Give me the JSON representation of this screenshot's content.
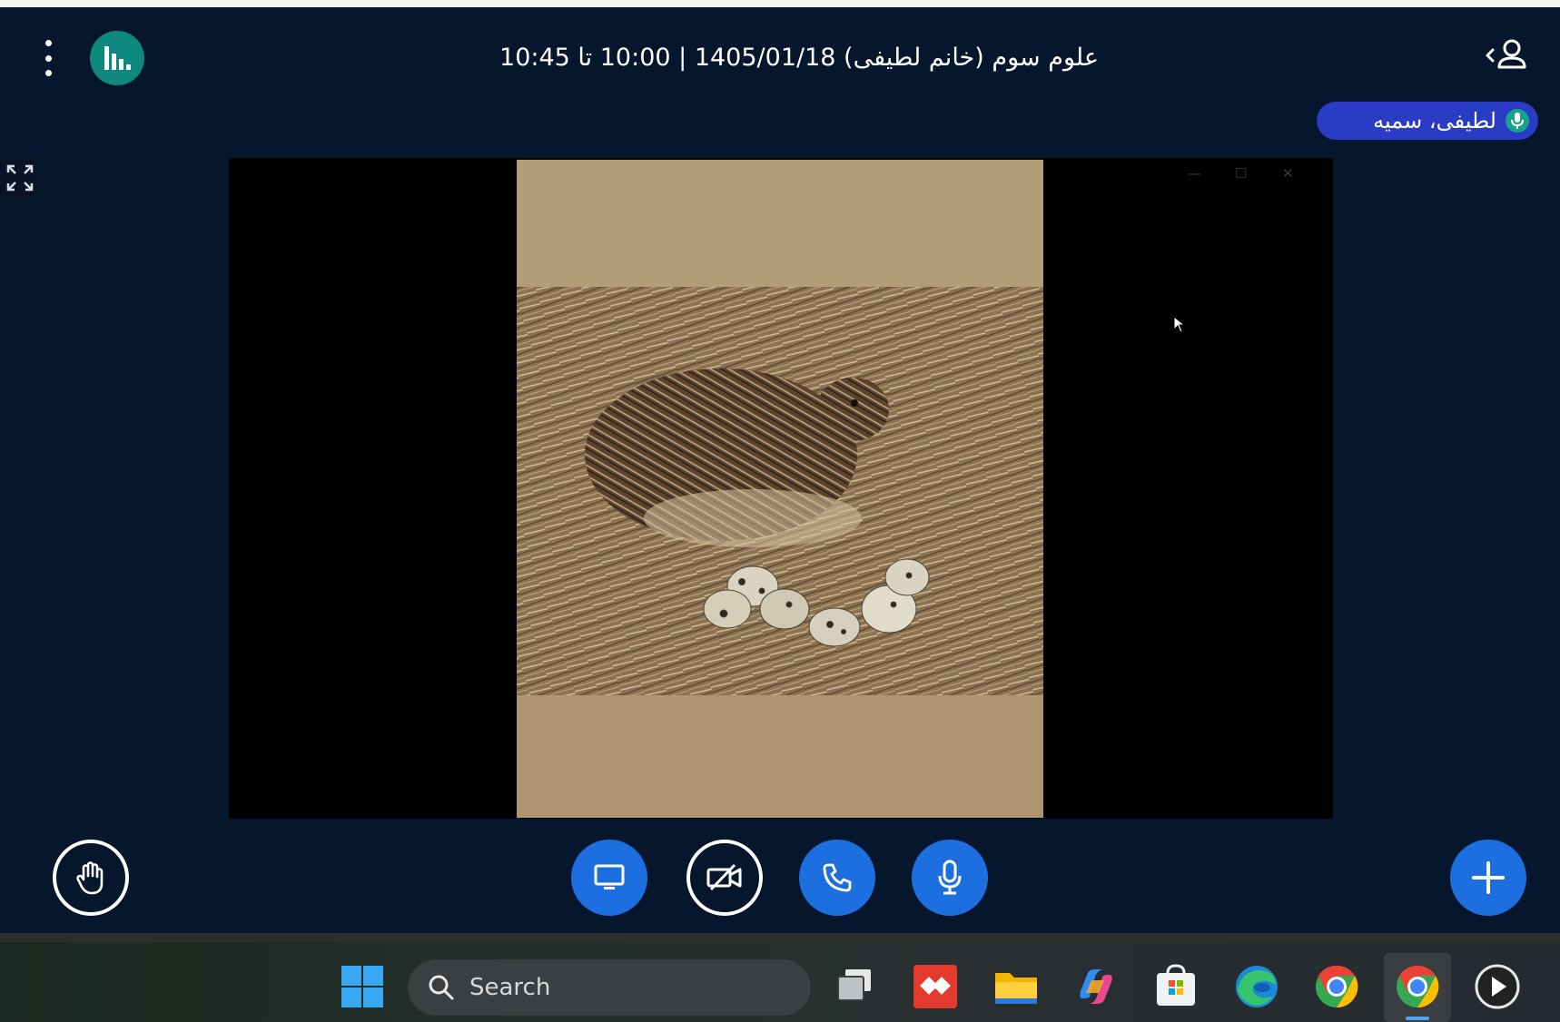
{
  "session": {
    "title": "علوم سوم (خانم لطیفی) 1405/01/18 | 10:00 تا 10:45"
  },
  "talker": {
    "name": "لطیفی، سمیه"
  },
  "taskbar": {
    "search_label": "Search"
  },
  "icons": {
    "more": "more-vertical-icon",
    "analytics": "bar-chart-icon",
    "users": "user-icon",
    "fullscreen": "fullscreen-icon",
    "raise_hand": "hand-icon",
    "share_screen": "monitor-icon",
    "camera": "video-off-icon",
    "phone": "phone-icon",
    "mic": "microphone-icon",
    "actions": "plus-icon"
  },
  "colors": {
    "background": "#06162c",
    "primary_blue": "#1d6fe0",
    "analytics_teal": "#0d8a7d",
    "talker_pill": "#2a3bc6",
    "talker_mic": "#17a389"
  }
}
